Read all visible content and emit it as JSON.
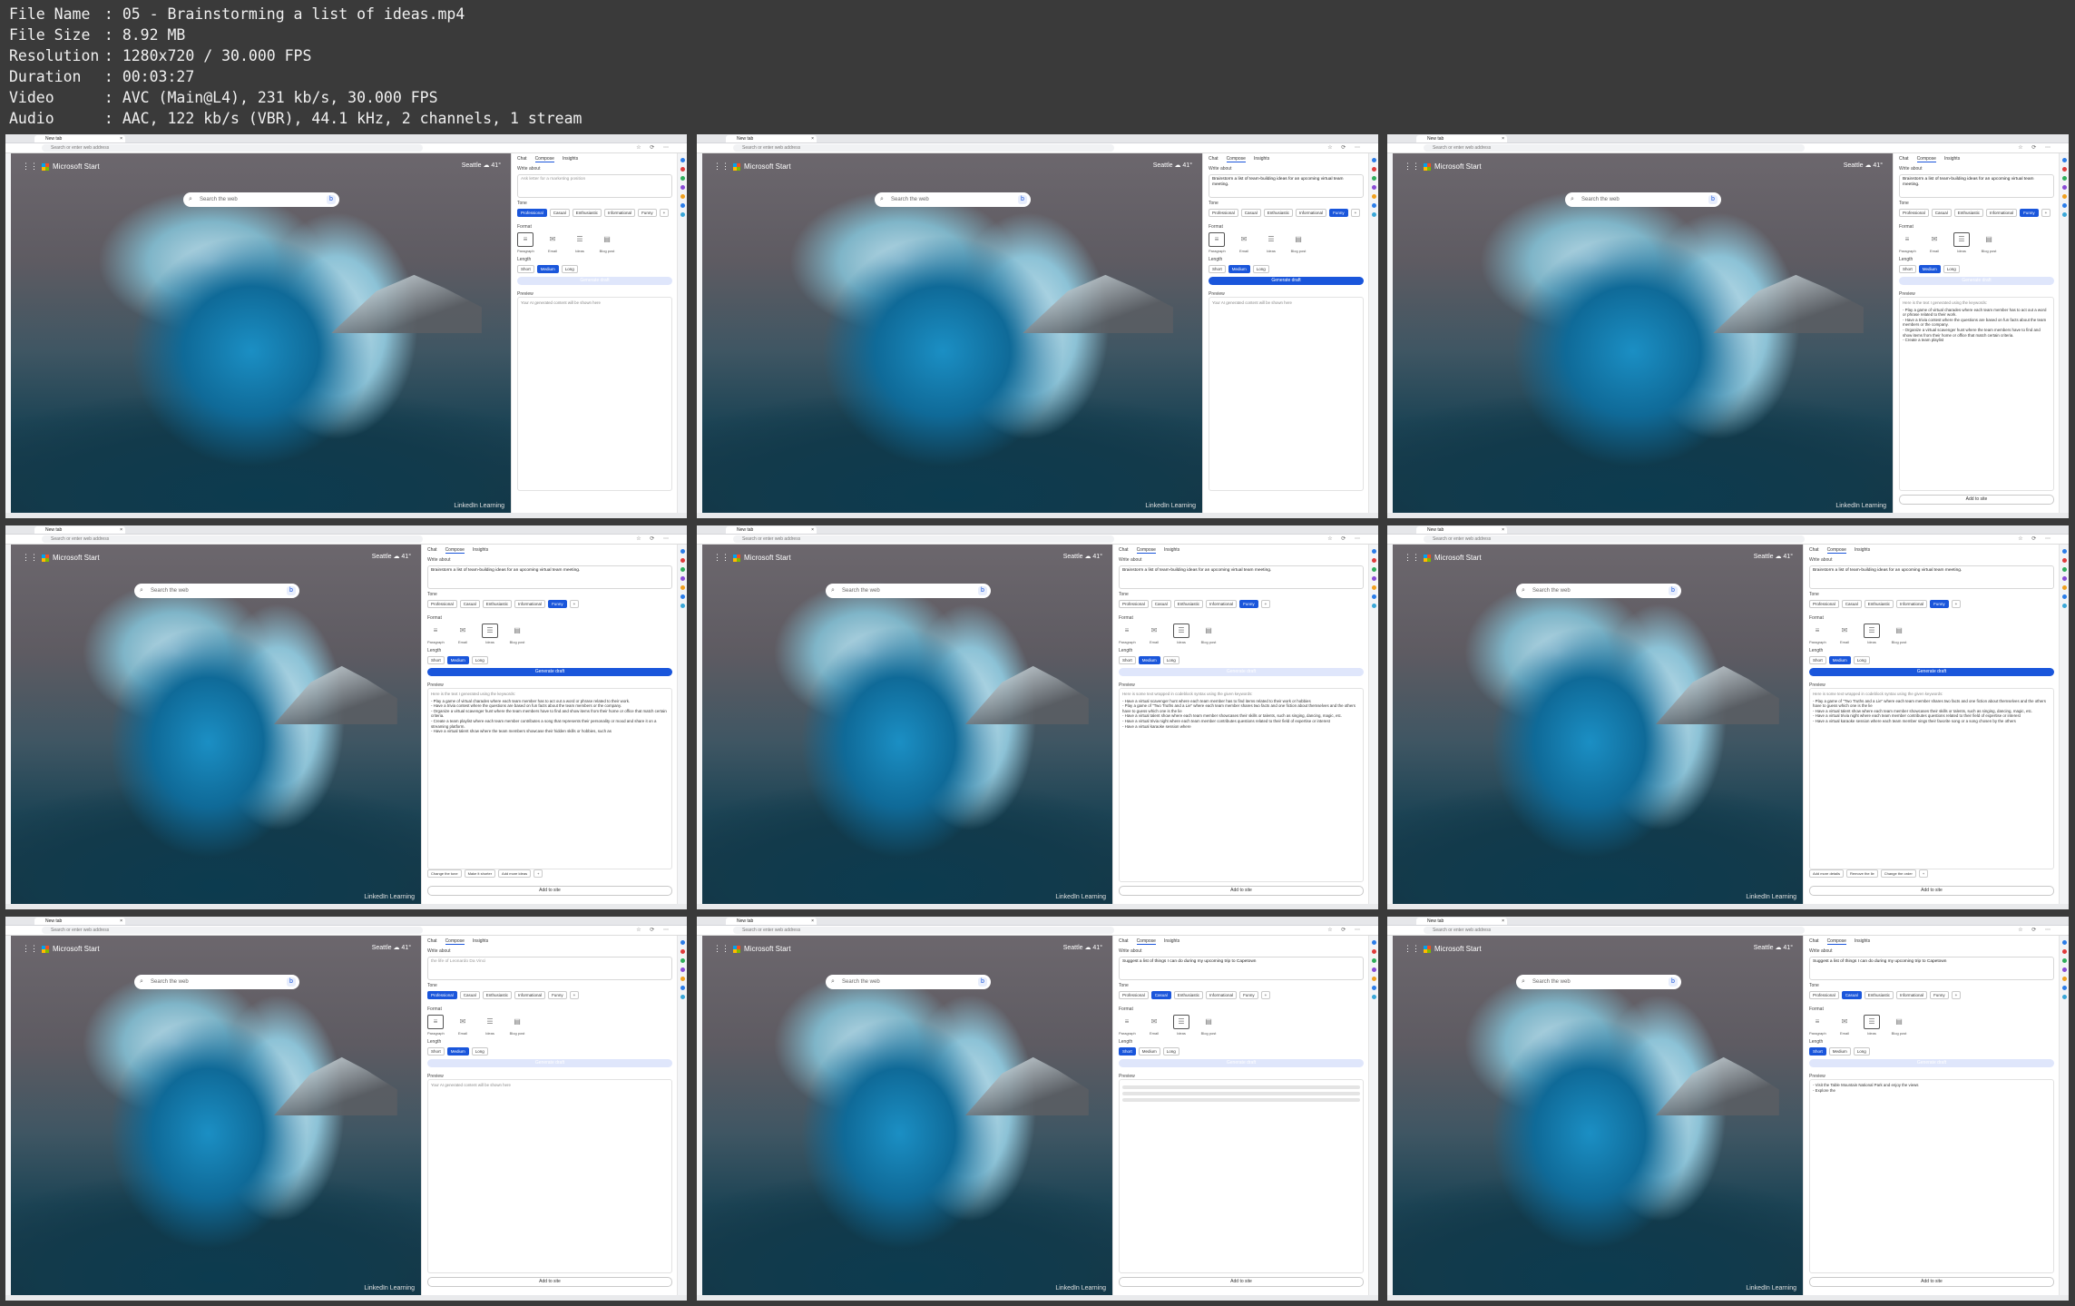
{
  "meta": {
    "file_name_label": "File Name",
    "file_name": "05 - Brainstorming a list of ideas.mp4",
    "file_size_label": "File Size",
    "file_size": "8.92 MB",
    "resolution_label": "Resolution",
    "resolution": "1280x720 / 30.000 FPS",
    "duration_label": "Duration",
    "duration": "00:03:27",
    "video_label": "Video",
    "video": "AVC (Main@L4), 231 kb/s, 30.000 FPS",
    "audio_label": "Audio",
    "audio": "AAC, 122 kb/s (VBR), 44.1 kHz, 2 channels, 1 stream"
  },
  "frames": [
    {
      "tab": "New tab",
      "url": "Search or enter web address",
      "brand": "Microsoft Start",
      "weather": "Seattle ☁ 41°",
      "search_placeholder": "Search the web",
      "ptabs": [
        "Chat",
        "Compose",
        "Insights"
      ],
      "write_about_label": "Write about",
      "write_about": "Ask letter for a marketing position",
      "write_about_placeholder": true,
      "tone_label": "Tone",
      "tones": [
        "Professional",
        "Casual",
        "Enthusiastic",
        "Informational",
        "Funny",
        "+"
      ],
      "tone_selected": 0,
      "format_label": "Format",
      "formats": [
        "Paragraph",
        "Email",
        "Ideas",
        "Blog post"
      ],
      "format_selected": 0,
      "length_label": "Length",
      "lengths": [
        "Short",
        "Medium",
        "Long"
      ],
      "length_selected": 1,
      "generate": "Generate draft",
      "generate_active": false,
      "preview_label": "Preview",
      "preview_title": "",
      "preview_placeholder": "Your AI generated content will be shown here",
      "preview_lines": [],
      "add": ""
    },
    {
      "tab": "New tab",
      "url": "Search or enter web address",
      "brand": "Microsoft Start",
      "weather": "Seattle ☁ 41°",
      "search_placeholder": "Search the web",
      "ptabs": [
        "Chat",
        "Compose",
        "Insights"
      ],
      "write_about_label": "Write about",
      "write_about": "Brainstorm a list of team-building ideas for an upcoming virtual team meeting.",
      "write_about_placeholder": false,
      "tone_label": "Tone",
      "tones": [
        "Professional",
        "Casual",
        "Enthusiastic",
        "Informational",
        "Funny",
        "+"
      ],
      "tone_selected": 4,
      "format_label": "Format",
      "formats": [
        "Paragraph",
        "Email",
        "Ideas",
        "Blog post"
      ],
      "format_selected": 0,
      "length_label": "Length",
      "lengths": [
        "Short",
        "Medium",
        "Long"
      ],
      "length_selected": 1,
      "generate": "Generate draft",
      "generate_active": true,
      "preview_label": "Preview",
      "preview_title": "",
      "preview_placeholder": "Your AI generated content will be shown here",
      "preview_lines": [],
      "add": ""
    },
    {
      "tab": "New tab",
      "url": "Search or enter web address",
      "brand": "Microsoft Start",
      "weather": "Seattle ☁ 41°",
      "search_placeholder": "Search the web",
      "ptabs": [
        "Chat",
        "Compose",
        "Insights"
      ],
      "write_about_label": "Write about",
      "write_about": "Brainstorm a list of team-building ideas for an upcoming virtual team meeting.",
      "write_about_placeholder": false,
      "tone_label": "Tone",
      "tones": [
        "Professional",
        "Casual",
        "Enthusiastic",
        "Informational",
        "Funny",
        "+"
      ],
      "tone_selected": 4,
      "format_label": "Format",
      "formats": [
        "Paragraph",
        "Email",
        "Ideas",
        "Blog post"
      ],
      "format_selected": 2,
      "length_label": "Length",
      "lengths": [
        "Short",
        "Medium",
        "Long"
      ],
      "length_selected": 1,
      "generate": "Generate draft",
      "generate_active": false,
      "preview_label": "Preview",
      "preview_title": "Here is the text I generated using the keywords:",
      "preview_placeholder": "",
      "preview_lines": [
        "- Play a game of virtual charades where each team member has to act out a word or phrase related to their work.",
        "- Have a trivia contest where the questions are based on fun facts about the team members or the company.",
        "- Organize a virtual scavenger hunt where the team members have to find and show items from their home or office that match certain criteria.",
        "- Create a team playlist"
      ],
      "add": "Add to site"
    },
    {
      "tab": "New tab",
      "url": "Search or enter web address",
      "brand": "Microsoft Start",
      "weather": "Seattle ☁ 41°",
      "search_placeholder": "Search the web",
      "ptabs": [
        "Chat",
        "Compose",
        "Insights"
      ],
      "write_about_label": "Write about",
      "write_about": "Brainstorm a list of team-building ideas for an upcoming virtual team meeting.",
      "write_about_placeholder": false,
      "tone_label": "Tone",
      "tones": [
        "Professional",
        "Casual",
        "Enthusiastic",
        "Informational",
        "Funny",
        "+"
      ],
      "tone_selected": 4,
      "format_label": "Format",
      "formats": [
        "Paragraph",
        "Email",
        "Ideas",
        "Blog post"
      ],
      "format_selected": 2,
      "length_label": "Length",
      "lengths": [
        "Short",
        "Medium",
        "Long"
      ],
      "length_selected": 1,
      "generate": "Generate draft",
      "generate_active": true,
      "preview_label": "Preview",
      "preview_title": "Here is the text I generated using the keywords:",
      "preview_placeholder": "",
      "preview_lines": [
        "- Play a game of virtual charades where each team member has to act out a word or phrase related to their work.",
        "- Have a trivia contest where the questions are based on fun facts about the team members or the company.",
        "- Organize a virtual scavenger hunt where the team members have to find and show items from their home or office that match certain criteria.",
        "- Create a team playlist where each team member contributes a song that represents their personality or mood and share it on a streaming platform.",
        "- Have a virtual talent show where the team members showcase their hidden skills or hobbies, such as"
      ],
      "suggestions": [
        "Change the tone",
        "Make it shorter",
        "Add more ideas",
        "+"
      ],
      "add": "Add to site"
    },
    {
      "tab": "New tab",
      "url": "Search or enter web address",
      "brand": "Microsoft Start",
      "weather": "Seattle ☁ 41°",
      "search_placeholder": "Search the web",
      "ptabs": [
        "Chat",
        "Compose",
        "Insights"
      ],
      "write_about_label": "Write about",
      "write_about": "Brainstorm a list of team-building ideas for an upcoming virtual team meeting.",
      "write_about_placeholder": false,
      "tone_label": "Tone",
      "tones": [
        "Professional",
        "Casual",
        "Enthusiastic",
        "Informational",
        "Funny",
        "+"
      ],
      "tone_selected": 4,
      "format_label": "Format",
      "formats": [
        "Paragraph",
        "Email",
        "Ideas",
        "Blog post"
      ],
      "format_selected": 2,
      "length_label": "Length",
      "lengths": [
        "Short",
        "Medium",
        "Long"
      ],
      "length_selected": 1,
      "generate": "Generate draft",
      "generate_active": false,
      "preview_label": "Preview",
      "preview_title": "Here is some text wrapped in codeblock syntax using the given keywords:",
      "preview_placeholder": "",
      "preview_lines": [
        "- Have a virtual scavenger hunt where each team member has to find items related to their work or hobbies",
        "- Play a game of \"Two Truths and a Lie\" where each team member shares two facts and one fiction about themselves and the others have to guess which one is the lie",
        "- Have a virtual talent show where each team member showcases their skills or talents, such as singing, dancing, magic, etc.",
        "- Have a virtual trivia night where each team member contributes questions related to their field of expertise or interest",
        "- Have a virtual karaoke session where"
      ],
      "add": "Add to site"
    },
    {
      "tab": "New tab",
      "url": "Search or enter web address",
      "brand": "Microsoft Start",
      "weather": "Seattle ☁ 41°",
      "search_placeholder": "Search the web",
      "ptabs": [
        "Chat",
        "Compose",
        "Insights"
      ],
      "write_about_label": "Write about",
      "write_about": "Brainstorm a list of team-building ideas for an upcoming virtual team meeting.",
      "write_about_placeholder": false,
      "tone_label": "Tone",
      "tones": [
        "Professional",
        "Casual",
        "Enthusiastic",
        "Informational",
        "Funny",
        "+"
      ],
      "tone_selected": 4,
      "format_label": "Format",
      "formats": [
        "Paragraph",
        "Email",
        "Ideas",
        "Blog post"
      ],
      "format_selected": 2,
      "length_label": "Length",
      "lengths": [
        "Short",
        "Medium",
        "Long"
      ],
      "length_selected": 1,
      "generate": "Generate draft",
      "generate_active": true,
      "preview_label": "Preview",
      "preview_title": "Here is some text wrapped in codeblock syntax using the given keywords:",
      "preview_placeholder": "",
      "preview_lines": [
        "- Play a game of \"Two Truths and a Lie\" where each team member shares two facts and one fiction about themselves and the others have to guess which one is the lie",
        "- Have a virtual talent show where each team member showcases their skills or talents, such as singing, dancing, magic, etc.",
        "- Have a virtual trivia night where each team member contributes questions related to their field of expertise or interest",
        "- Have a virtual karaoke session where each team member sings their favorite song or a song chosen by the others"
      ],
      "suggestions": [
        "Add more details",
        "Remove the lie",
        "Change the order",
        "+"
      ],
      "add": "Add to site"
    },
    {
      "tab": "New tab",
      "url": "Search or enter web address",
      "brand": "Microsoft Start",
      "weather": "Seattle ☁ 41°",
      "search_placeholder": "Search the web",
      "ptabs": [
        "Chat",
        "Compose",
        "Insights"
      ],
      "write_about_label": "Write about",
      "write_about": "the life of Leonardo Da Vinci",
      "write_about_placeholder": true,
      "tone_label": "Tone",
      "tones": [
        "Professional",
        "Casual",
        "Enthusiastic",
        "Informational",
        "Funny",
        "+"
      ],
      "tone_selected": 0,
      "format_label": "Format",
      "formats": [
        "Paragraph",
        "Email",
        "Ideas",
        "Blog post"
      ],
      "format_selected": 0,
      "length_label": "Length",
      "lengths": [
        "Short",
        "Medium",
        "Long"
      ],
      "length_selected": 1,
      "generate": "Generate draft",
      "generate_active": false,
      "preview_label": "Preview",
      "preview_title": "",
      "preview_placeholder": "Your AI generated content will be shown here",
      "preview_lines": [],
      "add": "Add to site"
    },
    {
      "tab": "New tab",
      "url": "Search or enter web address",
      "brand": "Microsoft Start",
      "weather": "Seattle ☁ 41°",
      "search_placeholder": "Search the web",
      "ptabs": [
        "Chat",
        "Compose",
        "Insights"
      ],
      "write_about_label": "Write about",
      "write_about": "Suggest a list of things I can do during my upcoming trip to Capetown",
      "write_about_placeholder": false,
      "tone_label": "Tone",
      "tones": [
        "Professional",
        "Casual",
        "Enthusiastic",
        "Informational",
        "Funny",
        "+"
      ],
      "tone_selected": 1,
      "format_label": "Format",
      "formats": [
        "Paragraph",
        "Email",
        "Ideas",
        "Blog post"
      ],
      "format_selected": 2,
      "length_label": "Length",
      "lengths": [
        "Short",
        "Medium",
        "Long"
      ],
      "length_selected": 0,
      "generate": "Generate draft",
      "generate_active": false,
      "preview_label": "Preview",
      "preview_title": "",
      "preview_placeholder": "",
      "preview_lines": [],
      "preview_loading": true,
      "add": "Add to site"
    },
    {
      "tab": "New tab",
      "url": "Search or enter web address",
      "brand": "Microsoft Start",
      "weather": "Seattle ☁ 41°",
      "search_placeholder": "Search the web",
      "ptabs": [
        "Chat",
        "Compose",
        "Insights"
      ],
      "write_about_label": "Write about",
      "write_about": "Suggest a list of things I can do during my upcoming trip to Capetown",
      "write_about_placeholder": false,
      "tone_label": "Tone",
      "tones": [
        "Professional",
        "Casual",
        "Enthusiastic",
        "Informational",
        "Funny",
        "+"
      ],
      "tone_selected": 1,
      "format_label": "Format",
      "formats": [
        "Paragraph",
        "Email",
        "Ideas",
        "Blog post"
      ],
      "format_selected": 2,
      "length_label": "Length",
      "lengths": [
        "Short",
        "Medium",
        "Long"
      ],
      "length_selected": 0,
      "generate": "Generate draft",
      "generate_active": false,
      "preview_label": "Preview",
      "preview_title": "",
      "preview_placeholder": "",
      "preview_lines": [
        "- Visit the Table Mountain National Park and enjoy the views",
        "- Explore the"
      ],
      "add": "Add to site"
    }
  ],
  "watermark": "LinkedIn Learning",
  "colors": {
    "accent": "#1a56db",
    "accent_disabled": "#dfe6fb",
    "text": "#f0f0f0",
    "background": "#3a3a3a"
  }
}
